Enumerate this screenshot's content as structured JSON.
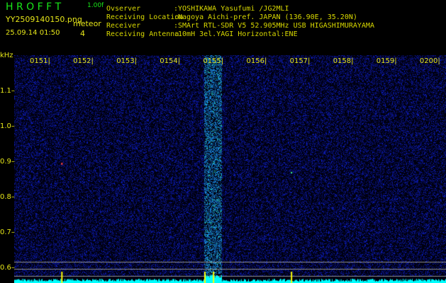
{
  "header": {
    "app_title": "H R O F F T",
    "version": "1.00f",
    "filename": "YY2509140150.png",
    "datetime": "25.09.14 01:50",
    "meteor_label": "meteor",
    "meteor_count": "4",
    "info": [
      {
        "label": "Ovserver",
        "value": ":YOSHIKAWA Yasufumi /JG2MLI"
      },
      {
        "label": "Receiving Location",
        "value": ":Nagoya Aichi-pref. JAPAN (136.90E, 35.20N)"
      },
      {
        "label": "Receiver",
        "value": ":SMArt RTL-SDR V5 52.905MHz USB HIGASHIMURAYAMA"
      },
      {
        "label": "Receiving Antenna",
        "value": ":10mH 3el.YAGI Horizontal:ENE"
      }
    ]
  },
  "colors": {
    "title": "#19e619",
    "labels": "#e6e619",
    "noise": "#1a2fd0",
    "spectrum": "#00ffff",
    "meteor_marker": "#ffff00"
  },
  "chart_data": {
    "type": "heatmap",
    "yunit": "kHz",
    "ylim": [
      0.55,
      1.2
    ],
    "y_ticks": [
      "1.1",
      "1.0",
      "0.9",
      "0.8",
      "0.7",
      "0.6"
    ],
    "x_ticks": [
      "0151",
      "0152",
      "0153",
      "0154",
      "0155",
      "0156",
      "0157",
      "0158",
      "0159",
      "0200"
    ],
    "meteor_markers_minutes": [
      "0151.3",
      "0154.6",
      "0154.8",
      "0156.6"
    ],
    "strong_band_minutes": [
      "0154.6",
      "0155.0"
    ]
  }
}
